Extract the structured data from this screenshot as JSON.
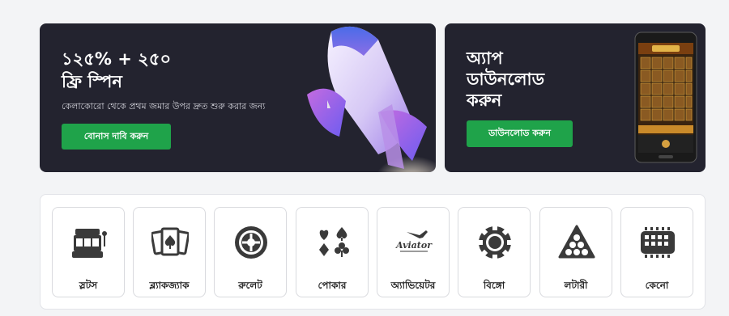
{
  "promo": {
    "title_line1": "১২৫% + ২৫০",
    "title_line2": "ফ্রি স্পিন",
    "subtitle": "কেলাকোরো থেকে প্রথম জমার উপর দ্রুত শুরু করার জন্য",
    "button": "বোনাস দাবি করুন"
  },
  "app": {
    "title_line1": "অ্যাপ",
    "title_line2": "ডাউনলোড",
    "title_line3": "করুন",
    "button": "ডাউনলোড করুন"
  },
  "games": [
    {
      "label": "স্লটস",
      "icon": "slot-machine-icon"
    },
    {
      "label": "ব্ল্যাকজ্যাক",
      "icon": "playing-cards-icon"
    },
    {
      "label": "রুলেট",
      "icon": "roulette-wheel-icon"
    },
    {
      "label": "পোকার",
      "icon": "card-suits-icon"
    },
    {
      "label": "অ্যাভিয়েটর",
      "icon": "aviator-plane-icon",
      "logo_text": "Aviator"
    },
    {
      "label": "বিঙ্গো",
      "icon": "bingo-chip-icon"
    },
    {
      "label": "লটারী",
      "icon": "lottery-balls-icon"
    },
    {
      "label": "কেনো",
      "icon": "keno-board-icon"
    }
  ],
  "colors": {
    "accent": "#1fa34a",
    "banner_bg": "#23232f",
    "icon": "#3a3a3a"
  }
}
